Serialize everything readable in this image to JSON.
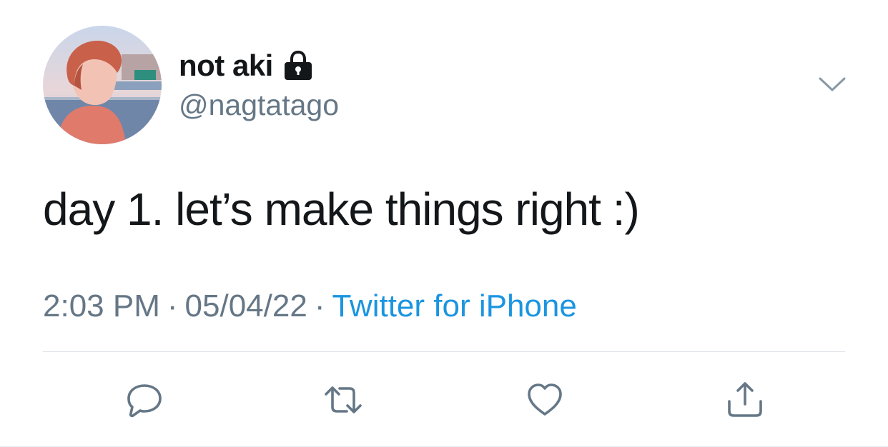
{
  "author": {
    "display_name": "not aki",
    "handle": "@nagtatago",
    "protected_icon": "lock-icon",
    "avatar_icon": "profile-photo"
  },
  "tweet": {
    "text": "day 1. let’s make things right :)",
    "time": "2:03 PM",
    "separator": "·",
    "date": "05/04/22",
    "source": "Twitter for iPhone"
  },
  "actions": {
    "menu_icon": "chevron-down-icon",
    "reply_icon": "reply-icon",
    "retweet_icon": "retweet-icon",
    "like_icon": "heart-icon",
    "share_icon": "share-icon"
  },
  "colors": {
    "text": "#14171a",
    "secondary": "#657786",
    "link": "#1b95e0",
    "divider": "#dfe3e8"
  }
}
